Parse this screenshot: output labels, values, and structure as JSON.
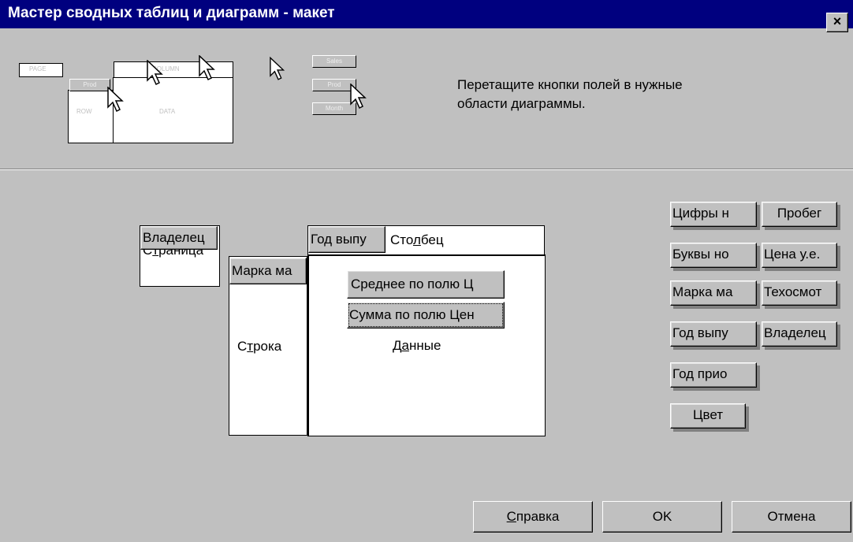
{
  "window": {
    "title": "Мастер сводных таблиц и диаграмм - макет",
    "close_glyph": "×"
  },
  "preview": {
    "page": "PAGE",
    "column": "COLUMN",
    "row": "ROW",
    "data": "DATA",
    "prod1": "Prod",
    "sales": "Sales",
    "prod2": "Prod",
    "month": "Month"
  },
  "instruction": "Перетащите кнопки полей в нужные\nобласти диаграммы.",
  "layout": {
    "page_field": "Владелец",
    "page_label_pre": "С",
    "page_label_u": "т",
    "page_label_post": "раница",
    "row_field": "Марка ма",
    "row_label_pre": "С",
    "row_label_u": "т",
    "row_label_post": "рока",
    "column_field": "Год выпу",
    "column_label_pre": "Сто",
    "column_label_u": "л",
    "column_label_post": "бец",
    "data_field_1": "Среднее по полю Ц",
    "data_field_2": "Сумма по полю Цен",
    "data_label_pre": "Д",
    "data_label_u": "а",
    "data_label_post": "нные"
  },
  "fields_left": [
    "Цифры н",
    "Буквы но",
    "Марка ма",
    "Год выпу",
    "Год прио",
    "Цвет"
  ],
  "fields_right": [
    "Пробег",
    "Цена у.е.",
    "Техосмот",
    "Владелец"
  ],
  "buttons": {
    "help_pre": "",
    "help_u": "С",
    "help_post": "правка",
    "ok": "OK",
    "cancel": "Отмена"
  }
}
